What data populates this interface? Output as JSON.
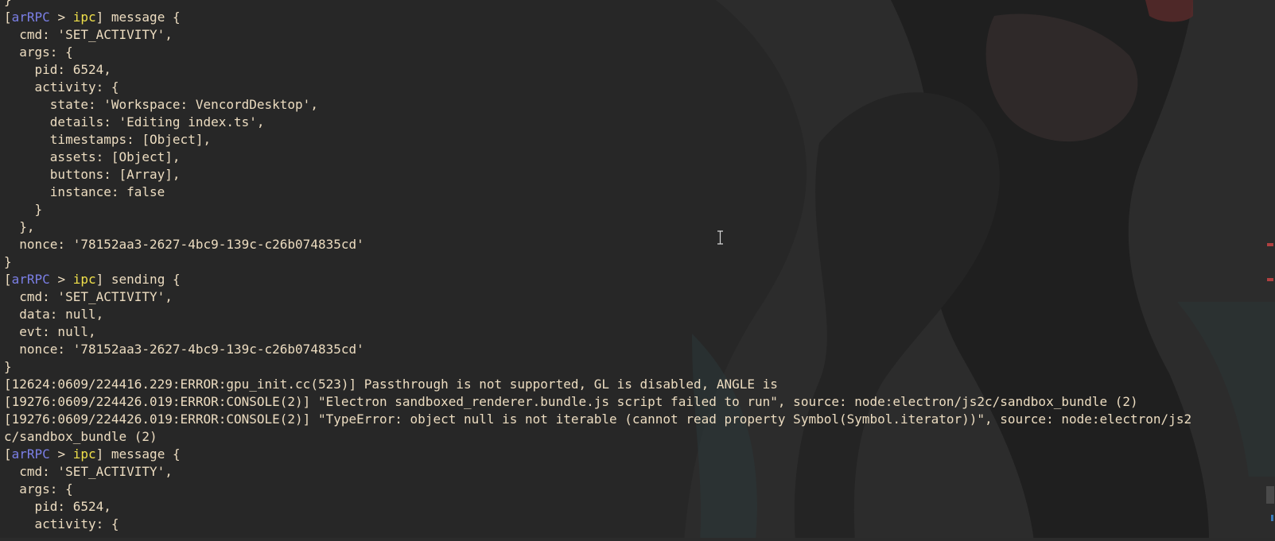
{
  "terminal": {
    "background": "#272727",
    "text_color": "#ecdcc0",
    "arrpc_color": "#7b7fe6",
    "ipc_color": "#f0e04a",
    "lines": [
      {
        "kind": "plain",
        "text": "}"
      },
      {
        "kind": "ipc",
        "prefix": "[",
        "app": "arRPC",
        "sep": " > ",
        "chan": "ipc",
        "suffix": "] message {"
      },
      {
        "kind": "plain",
        "text": "  cmd: 'SET_ACTIVITY',"
      },
      {
        "kind": "plain",
        "text": "  args: {"
      },
      {
        "kind": "plain",
        "text": "    pid: 6524,"
      },
      {
        "kind": "plain",
        "text": "    activity: {"
      },
      {
        "kind": "plain",
        "text": "      state: 'Workspace: VencordDesktop',"
      },
      {
        "kind": "plain",
        "text": "      details: 'Editing index.ts',"
      },
      {
        "kind": "plain",
        "text": "      timestamps: [Object],"
      },
      {
        "kind": "plain",
        "text": "      assets: [Object],"
      },
      {
        "kind": "plain",
        "text": "      buttons: [Array],"
      },
      {
        "kind": "plain",
        "text": "      instance: false"
      },
      {
        "kind": "plain",
        "text": "    }"
      },
      {
        "kind": "plain",
        "text": "  },"
      },
      {
        "kind": "plain",
        "text": "  nonce: '78152aa3-2627-4bc9-139c-c26b074835cd'"
      },
      {
        "kind": "plain",
        "text": "}"
      },
      {
        "kind": "ipc",
        "prefix": "[",
        "app": "arRPC",
        "sep": " > ",
        "chan": "ipc",
        "suffix": "] sending {"
      },
      {
        "kind": "plain",
        "text": "  cmd: 'SET_ACTIVITY',"
      },
      {
        "kind": "plain",
        "text": "  data: null,"
      },
      {
        "kind": "plain",
        "text": "  evt: null,"
      },
      {
        "kind": "plain",
        "text": "  nonce: '78152aa3-2627-4bc9-139c-c26b074835cd'"
      },
      {
        "kind": "plain",
        "text": "}"
      },
      {
        "kind": "plain",
        "text": "[12624:0609/224416.229:ERROR:gpu_init.cc(523)] Passthrough is not supported, GL is disabled, ANGLE is"
      },
      {
        "kind": "plain",
        "text": "[19276:0609/224426.019:ERROR:CONSOLE(2)] \"Electron sandboxed_renderer.bundle.js script failed to run\", source: node:electron/js2c/sandbox_bundle (2)"
      },
      {
        "kind": "plain",
        "text": "[19276:0609/224426.019:ERROR:CONSOLE(2)] \"TypeError: object null is not iterable (cannot read property Symbol(Symbol.iterator))\", source: node:electron/js2"
      },
      {
        "kind": "plain",
        "text": "c/sandbox_bundle (2)"
      },
      {
        "kind": "ipc",
        "prefix": "[",
        "app": "arRPC",
        "sep": " > ",
        "chan": "ipc",
        "suffix": "] message {"
      },
      {
        "kind": "plain",
        "text": "  cmd: 'SET_ACTIVITY',"
      },
      {
        "kind": "plain",
        "text": "  args: {"
      },
      {
        "kind": "plain",
        "text": "    pid: 6524,"
      },
      {
        "kind": "plain",
        "text": "    activity: {"
      }
    ]
  },
  "icons": {
    "cursor": "text-cursor-icon",
    "background": "anime-wallpaper-art"
  }
}
